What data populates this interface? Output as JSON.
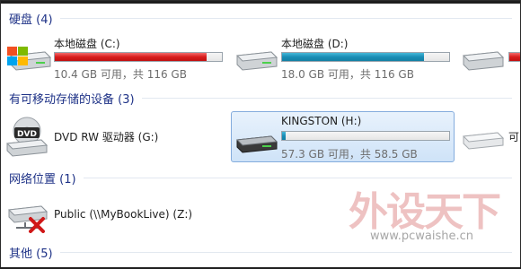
{
  "sections": {
    "hard_disks": {
      "header": "硬盘 (4)"
    },
    "removable": {
      "header": "有可移动存储的设备 (3)"
    },
    "network": {
      "header": "网络位置 (1)"
    },
    "other": {
      "header": "其他 (5)"
    }
  },
  "drives": {
    "c": {
      "name": "本地磁盘 (C:)",
      "free_text": "10.4 GB 可用，共 116 GB",
      "used_fraction": 0.91,
      "bar_color": "#d81c1c"
    },
    "d": {
      "name": "本地磁盘 (D:)",
      "free_text": "18.0 GB 可用，共 116 GB",
      "used_fraction": 0.85,
      "bar_color": "#1a8db5"
    },
    "g": {
      "name": "DVD RW 驱动器 (G:)"
    },
    "h": {
      "name": "KINGSTON (H:)",
      "free_text": "57.3 GB 可用，共 58.5 GB",
      "used_fraction": 0.02,
      "bar_color": "#1a8db5"
    },
    "partial_right_label": "可",
    "network_z": {
      "name": "Public (\\\\MyBookLive) (Z:)"
    }
  },
  "icon_labels": {
    "dvd": "DVD"
  },
  "watermark": {
    "brand": "外设天下",
    "url": "www.pcwaishe.cn"
  }
}
